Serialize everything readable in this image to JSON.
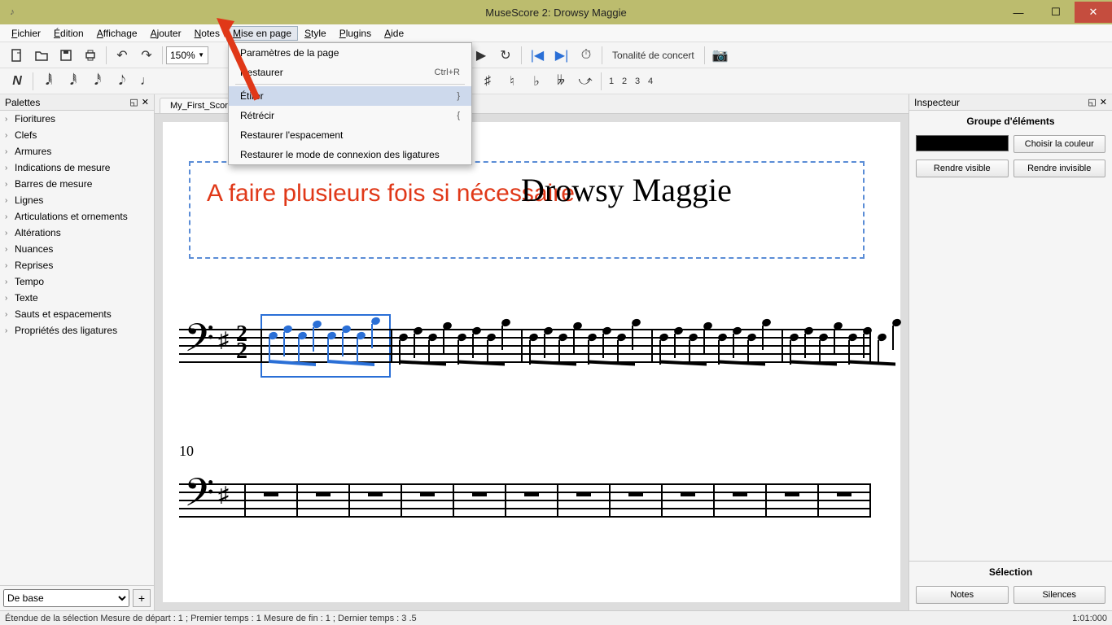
{
  "window": {
    "title": "MuseScore 2: Drowsy Maggie"
  },
  "menus": [
    "Fichier",
    "Édition",
    "Affichage",
    "Ajouter",
    "Notes",
    "Mise en page",
    "Style",
    "Plugins",
    "Aide"
  ],
  "active_menu_index": 5,
  "dropdown": {
    "items": [
      {
        "label": "Paramètres de la page",
        "shortcut": ""
      },
      {
        "label": "Restaurer",
        "shortcut": "Ctrl+R"
      },
      {
        "type": "divider"
      },
      {
        "label": "Étirer",
        "shortcut": "}",
        "highlight": true
      },
      {
        "label": "Rétrécir",
        "shortcut": "{"
      },
      {
        "label": "Restaurer l'espacement",
        "shortcut": ""
      },
      {
        "label": "Restaurer le mode de connexion des ligatures",
        "shortcut": ""
      }
    ]
  },
  "toolbar1": {
    "zoom": "150%",
    "concert_pitch": "Tonalité de concert",
    "voice_numbers": [
      "1",
      "2",
      "3",
      "4"
    ]
  },
  "tabs": [
    "My_First_Score"
  ],
  "annotation": "A faire plusieurs fois si nécessaire",
  "score": {
    "title": "Drowsy Maggie",
    "measure_number_row2": "10"
  },
  "palettes": {
    "title": "Palettes",
    "items": [
      "Fioritures",
      "Clefs",
      "Armures",
      "Indications de mesure",
      "Barres de mesure",
      "Lignes",
      "Articulations et ornements",
      "Altérations",
      "Nuances",
      "Reprises",
      "Tempo",
      "Texte",
      "Sauts et espacements",
      "Propriétés des ligatures"
    ],
    "footer_select": "De base"
  },
  "inspector": {
    "title": "Inspecteur",
    "group_label": "Groupe d'éléments",
    "choose_color": "Choisir la couleur",
    "make_visible": "Rendre visible",
    "make_invisible": "Rendre invisible",
    "selection_label": "Sélection",
    "notes_btn": "Notes",
    "rests_btn": "Silences"
  },
  "statusbar": {
    "left": "Étendue de la sélection Mesure de départ : 1 ; Premier temps : 1 Mesure de fin : 1 ; Dernier temps : 3 .5",
    "right": "1:01:000"
  }
}
